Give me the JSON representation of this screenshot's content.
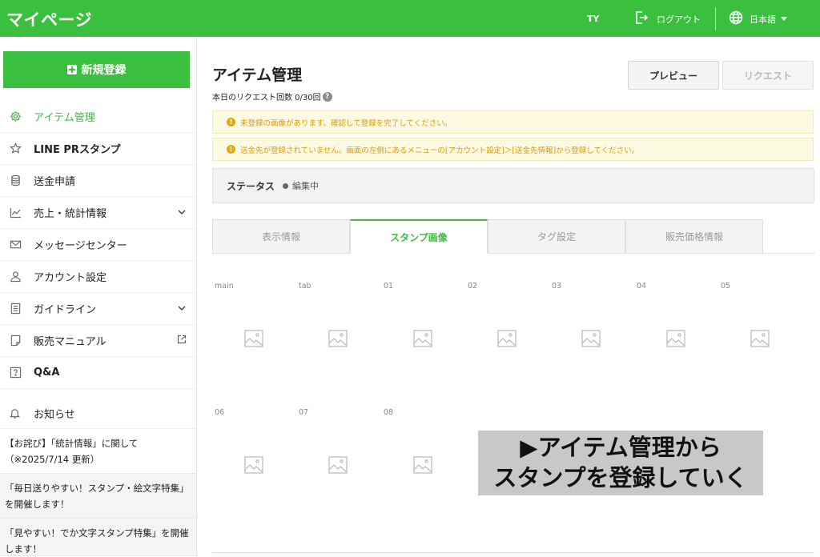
{
  "header": {
    "brand": "マイページ",
    "initials": "TY",
    "logout_label": "ログアウト",
    "language_label": "日本語"
  },
  "sidebar": {
    "new_button_label": "新規登録",
    "items": [
      {
        "label": "アイテム管理",
        "icon": "gear-icon",
        "active": true
      },
      {
        "label": "LINE PRスタンプ",
        "icon": "star-icon"
      },
      {
        "label": "送金申請",
        "icon": "coins-icon"
      },
      {
        "label": "売上・統計情報",
        "icon": "chart-icon",
        "expandable": true
      },
      {
        "label": "メッセージセンター",
        "icon": "mail-icon"
      },
      {
        "label": "アカウント設定",
        "icon": "user-icon"
      },
      {
        "label": "ガイドライン",
        "icon": "document-icon",
        "expandable": true
      },
      {
        "label": "販売マニュアル",
        "icon": "note-icon",
        "external": true
      },
      {
        "label": "Q&A",
        "icon": "question-icon"
      }
    ],
    "notices_title": "お知らせ",
    "notices": [
      "【お詫び】「統計情報」に関して（※2025/7/14 更新）",
      "「毎日送りやすい！スタンプ・絵文字特集」を開催します！",
      "「見やすい！でか文字スタンプ特集」を開催します！"
    ]
  },
  "main": {
    "title": "アイテム管理",
    "request_count": "本日のリクエスト回数 0/30回",
    "preview_label": "プレビュー",
    "request_label": "リクエスト",
    "alerts": [
      "未登録の画像があります。確認して登録を完了してください。",
      "送金先が登録されていません。画面の左側にあるメニューの[アカウント設定]＞[送金先情報]から登録してください。"
    ],
    "status_label": "ステータス",
    "status_value": "編集中",
    "tabs": [
      "表示情報",
      "スタンプ画像",
      "タグ設定",
      "販売価格情報"
    ],
    "active_tab": "スタンプ画像",
    "slots": [
      "main",
      "tab",
      "01",
      "02",
      "03",
      "04",
      "05",
      "06",
      "07",
      "08"
    ]
  },
  "overlay": {
    "line1": "▶アイテム管理から",
    "line2": "スタンプを登録していく"
  },
  "colors": {
    "brand_green": "#3bbf3f",
    "alert_text": "#e09a00",
    "alert_bg": "#fdfae4"
  }
}
